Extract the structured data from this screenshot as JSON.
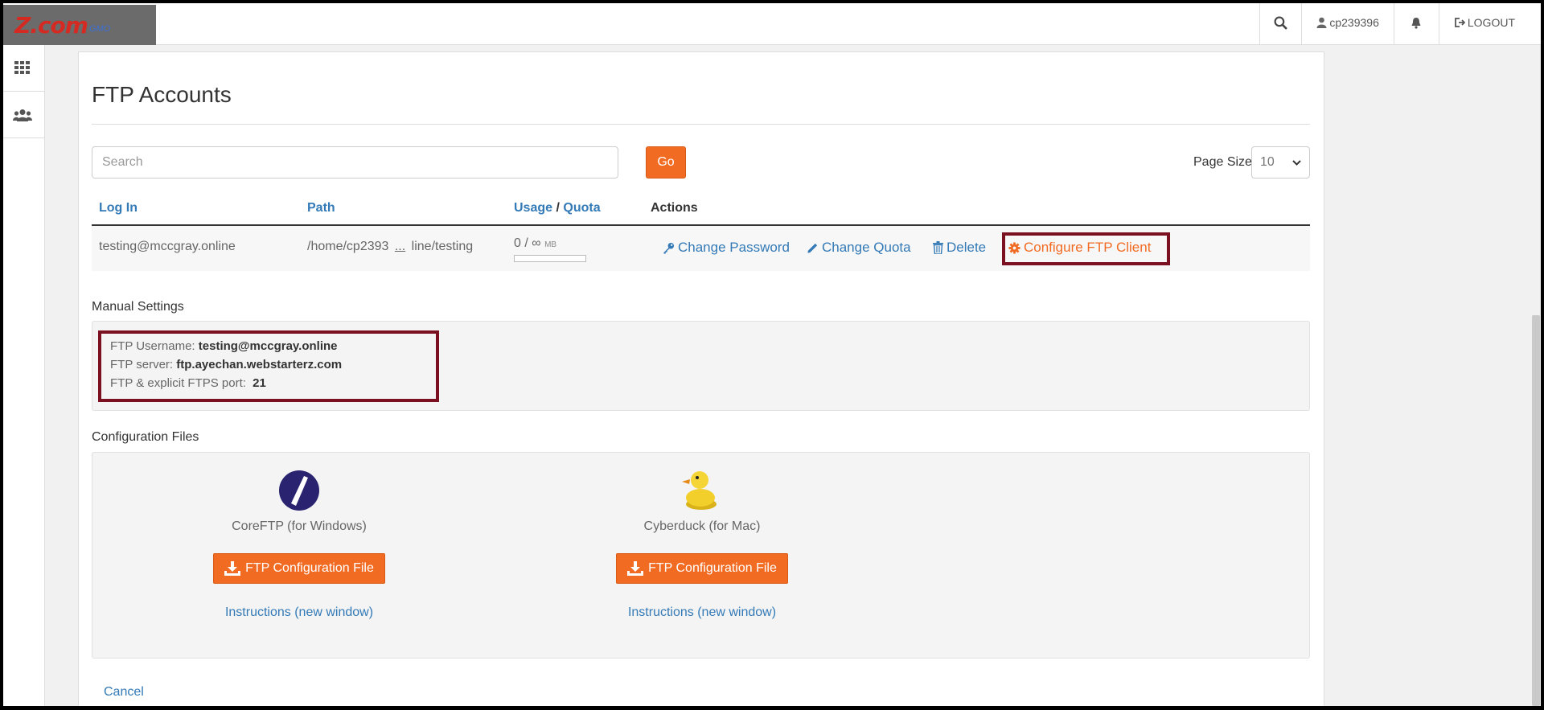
{
  "header": {
    "logo_text": "Z.com",
    "logo_sub": "GMO",
    "username": "cp239396",
    "logout_label": "LOGOUT"
  },
  "page": {
    "title": "FTP Accounts"
  },
  "search": {
    "placeholder": "Search",
    "go_label": "Go"
  },
  "page_size": {
    "label": "Page Size",
    "value": "10"
  },
  "table": {
    "columns": {
      "login": "Log In",
      "path": "Path",
      "usage": "Usage",
      "slash": "/",
      "quota": "Quota",
      "actions": "Actions"
    },
    "row": {
      "login": "testing@mccgray.online",
      "path_start": "/home/cp2393",
      "path_ellipsis": "...",
      "path_end": "line/testing",
      "usage": "0 / ∞",
      "usage_unit": "MB",
      "usage_fraction": 0
    },
    "actions": {
      "change_password": "Change Password",
      "change_quota": "Change Quota",
      "delete": "Delete",
      "configure": "Configure FTP Client"
    }
  },
  "manual": {
    "heading": "Manual Settings",
    "username_label": "FTP Username:",
    "username_value": "testing@mccgray.online",
    "server_label": "FTP server:",
    "server_value": "ftp.ayechan.webstarterz.com",
    "port_label": "FTP & explicit FTPS port:",
    "port_value": "21"
  },
  "config_files": {
    "heading": "Configuration Files",
    "clients": [
      {
        "name": "CoreFTP (for Windows)",
        "button": "FTP Configuration File",
        "instructions": "Instructions (new window)"
      },
      {
        "name": "Cyberduck (for Mac)",
        "button": "FTP Configuration File",
        "instructions": "Instructions (new window)"
      }
    ]
  },
  "cancel_label": "Cancel",
  "colors": {
    "accent": "#f26b22",
    "link": "#337ab7",
    "highlight": "#7a1020"
  }
}
